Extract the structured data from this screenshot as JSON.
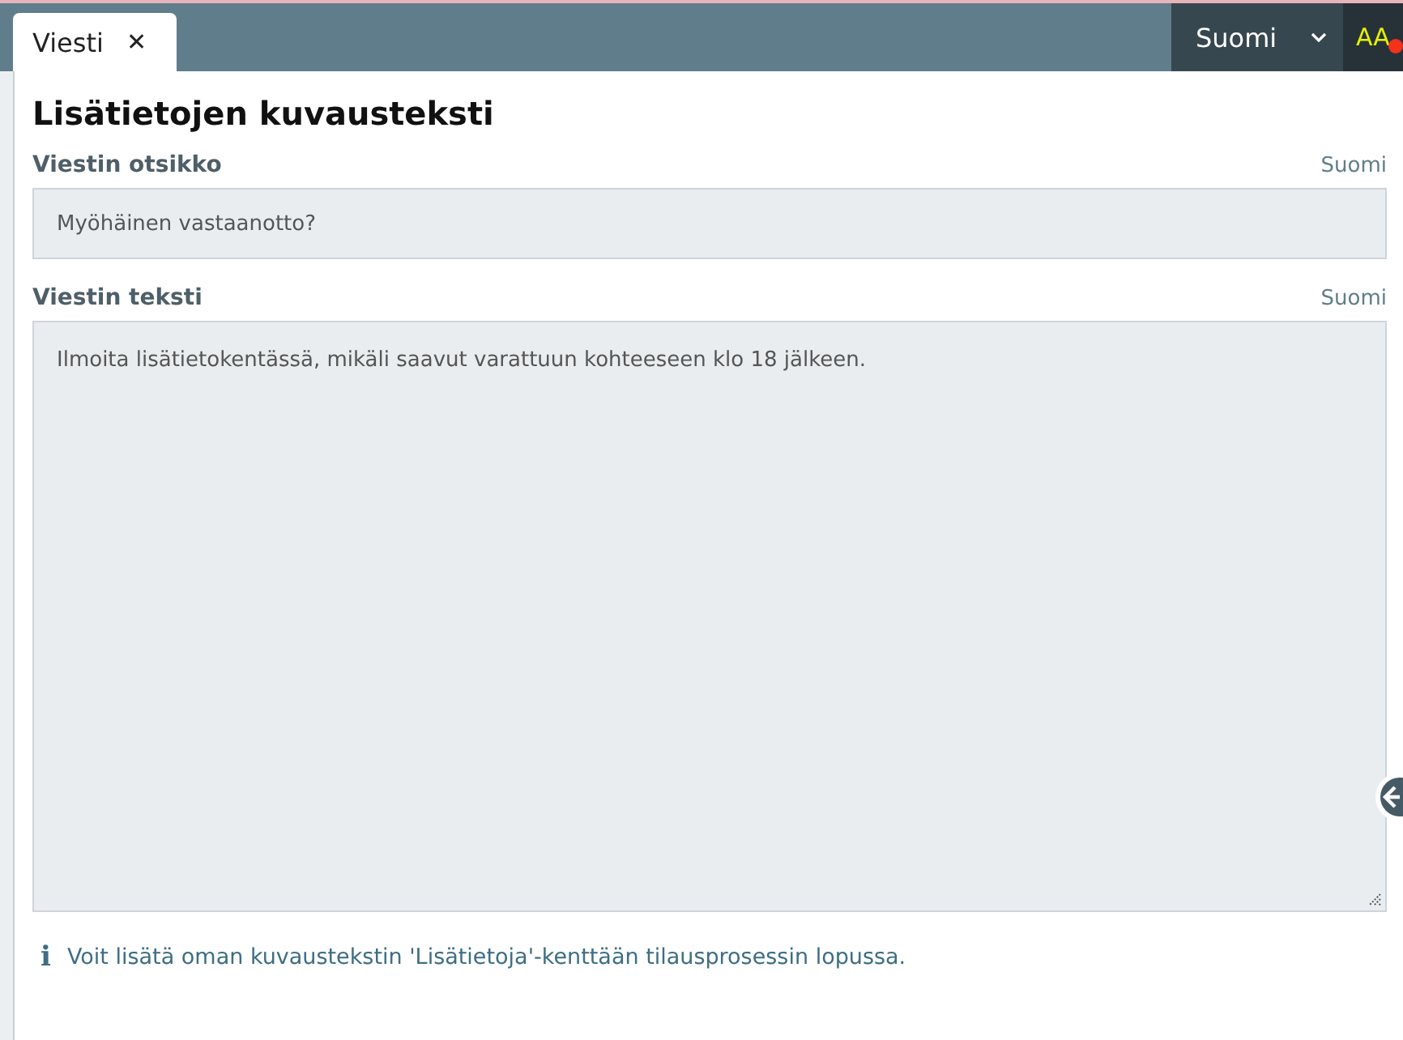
{
  "tabs": [
    {
      "label": "Viesti",
      "close": "✕",
      "selected": true
    }
  ],
  "language_menu": {
    "value": "Suomi"
  },
  "accessibility_button": {
    "label": "AA",
    "notification": true
  },
  "title": "Lisätietojen kuvausteksti",
  "fields": [
    {
      "kind": "input",
      "label": "Viestin otsikko",
      "language": "Suomi",
      "value": "Myöhäinen vastaanotto?"
    },
    {
      "kind": "textarea",
      "label": "Viestin teksti",
      "language": "Suomi",
      "value": "Ilmoita lisätietokentässä, mikäli saavut varattuun kohteeseen klo 18 jälkeen."
    }
  ],
  "info_icon": "i",
  "info": "Voit lisätä oman kuvaustekstin 'Lisätietoja'-kenttään tilausprosessin lopussa."
}
